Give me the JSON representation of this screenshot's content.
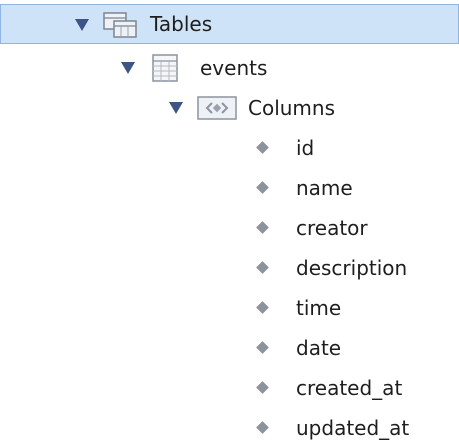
{
  "tree": {
    "root": {
      "label": "Tables",
      "icon": "tables-folder-icon",
      "expanded": true,
      "selected": true
    },
    "table": {
      "label": "events",
      "icon": "table-grid-icon",
      "expanded": true
    },
    "group": {
      "label": "Columns",
      "icon": "columns-folder-icon",
      "expanded": true
    },
    "columns": [
      "id",
      "name",
      "creator",
      "description",
      "time",
      "date",
      "created_at",
      "updated_at"
    ]
  },
  "colors": {
    "selection_background": "#cfe3f8",
    "selection_border": "#8fb6e2",
    "expander": "#3b5584",
    "column_bullet": "#8d939b"
  }
}
